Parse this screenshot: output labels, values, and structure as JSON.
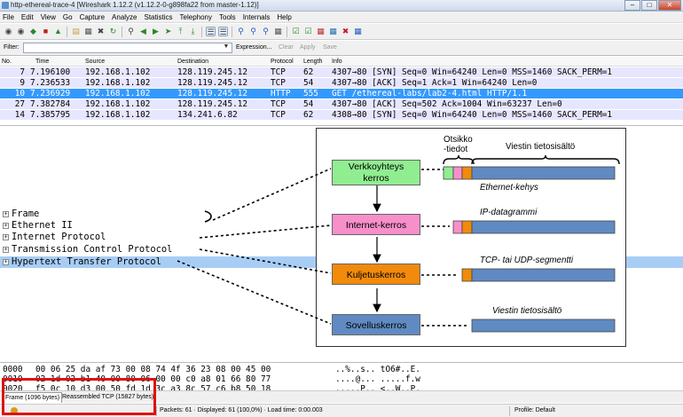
{
  "window": {
    "title": "http-ethereal-trace-4   [Wireshark 1.12.2  (v1.12.2-0-g898fa22 from master-1.12)]",
    "minimize": "–",
    "maximize": "□",
    "close": "✕"
  },
  "menu": [
    "File",
    "Edit",
    "View",
    "Go",
    "Capture",
    "Analyze",
    "Statistics",
    "Telephony",
    "Tools",
    "Internals",
    "Help"
  ],
  "filter": {
    "label": "Filter:",
    "value": "",
    "expression": "Expression...",
    "clear": "Clear",
    "apply": "Apply",
    "save": "Save"
  },
  "packet_list": {
    "headers": {
      "no": "No.",
      "time": "Time",
      "source": "Source",
      "destination": "Destination",
      "protocol": "Protocol",
      "length": "Length",
      "info": "Info"
    },
    "rows": [
      {
        "no": "7",
        "time": "7.196100",
        "source": "192.168.1.102",
        "destination": "128.119.245.12",
        "protocol": "TCP",
        "length": "62",
        "info": "4307→80 [SYN] Seq=0 Win=64240 Len=0 MSS=1460 SACK_PERM=1",
        "kind": "tcp"
      },
      {
        "no": "9",
        "time": "7.236533",
        "source": "192.168.1.102",
        "destination": "128.119.245.12",
        "protocol": "TCP",
        "length": "54",
        "info": "4307→80 [ACK] Seq=1 Ack=1 Win=64240 Len=0",
        "kind": "tcp"
      },
      {
        "no": "10",
        "time": "7.236929",
        "source": "192.168.1.102",
        "destination": "128.119.245.12",
        "protocol": "HTTP",
        "length": "555",
        "info": "GET /ethereal-labs/lab2-4.html HTTP/1.1",
        "kind": "sel"
      },
      {
        "no": "27",
        "time": "7.382784",
        "source": "192.168.1.102",
        "destination": "128.119.245.12",
        "protocol": "TCP",
        "length": "54",
        "info": "4307→80 [ACK] Seq=502 Ack=1004 Win=63237 Len=0",
        "kind": "tcp"
      },
      {
        "no": "14",
        "time": "7.385795",
        "source": "192.168.1.102",
        "destination": "134.241.6.82",
        "protocol": "TCP",
        "length": "62",
        "info": "4308→80 [SYN] Seq=0 Win=64240 Len=0 MSS=1460 SACK_PERM=1",
        "kind": "tcp"
      }
    ]
  },
  "details": {
    "rows": [
      {
        "text": "Frame",
        "highlight": false
      },
      {
        "text": "Ethernet II",
        "highlight": false
      },
      {
        "text": "Internet Protocol",
        "highlight": false
      },
      {
        "text": "Transmission Control Protocol",
        "highlight": false
      },
      {
        "text": "Hypertext Transfer Protocol",
        "highlight": true
      }
    ],
    "expander_glyph": "+"
  },
  "diagram": {
    "layers": [
      {
        "name": "Verkkoyhteys\nkerros",
        "color": "#90ee90"
      },
      {
        "name": "Internet-kerros",
        "color": "#f78fcb"
      },
      {
        "name": "Kuljetuskerros",
        "color": "#f28a0c"
      },
      {
        "name": "Sovelluskerros",
        "color": "#5f8ac2"
      }
    ],
    "header_label": "Otsikko\n-tiedot",
    "payload_label": "Viestin tietosisältö",
    "frame_labels": [
      "Ethernet-kehys",
      "IP-datagrammi",
      "TCP- tai UDP-segmentti",
      "Viestin tietosisältö"
    ],
    "colors": {
      "payload": "#5f8ac2",
      "ethernet_header": "#90ee90",
      "ip_header": "#f78fcb",
      "tcp_header": "#f28a0c"
    }
  },
  "hex": {
    "rows": [
      {
        "offset": "0000",
        "bytes": "00 06 25 da af 73 00 08  74 4f 36 23 08 00 45 00",
        "ascii": "..%..s.. tO6#..E."
      },
      {
        "offset": "0010",
        "bytes": "02 1d 02 b1 40 00 80 06  00 00 c0 a8 01 66 80 77",
        "ascii": "....@... .....f.w"
      },
      {
        "offset": "0020",
        "bytes": "f5 0c 10 d3 00 50 fd 1d  3c a3 8c 57 c6 b8 50 18",
        "ascii": ".....P.. <..W..P."
      }
    ]
  },
  "hex_tabs": [
    "Frame (1096 bytes)",
    "Reassembled TCP (15827 bytes)"
  ],
  "status": {
    "packets": "Packets: 61 · Displayed: 61 (100,0%) · Load time: 0:00.003",
    "profile": "Profile: Default"
  }
}
